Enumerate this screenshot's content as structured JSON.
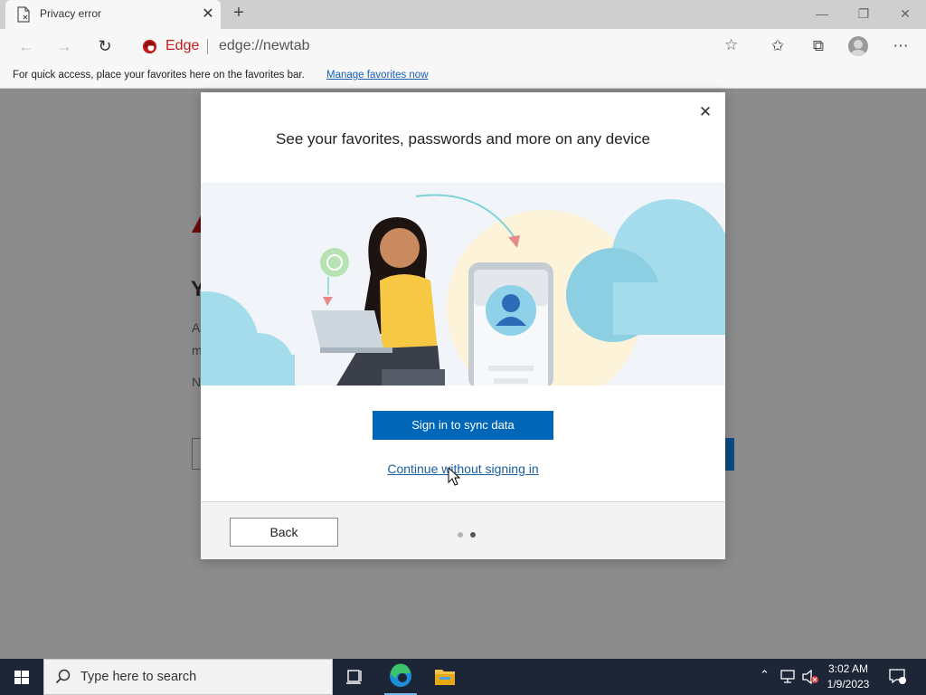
{
  "browser": {
    "tab": {
      "title": "Privacy error"
    },
    "omnibox": {
      "site_label": "Edge",
      "url": "edge://newtab"
    },
    "favorites_bar": {
      "text": "For quick access, place your favorites here on the favorites bar.",
      "link": "Manage favorites now"
    }
  },
  "background_page": {
    "fragments": [
      "Y",
      "A",
      "m",
      "N"
    ]
  },
  "dialog": {
    "title": "See your favorites, passwords and more on any device",
    "primary_button": "Sign in to sync data",
    "secondary_link": "Continue without signing in",
    "back_button": "Back",
    "pagination": {
      "total": 2,
      "current": 2
    }
  },
  "taskbar": {
    "search_placeholder": "Type here to search",
    "time": "3:02 AM",
    "date": "1/9/2023"
  },
  "colors": {
    "primary_button": "#0067b8",
    "edge_brand_red": "#c11a1a",
    "taskbar": "#1c2636"
  }
}
